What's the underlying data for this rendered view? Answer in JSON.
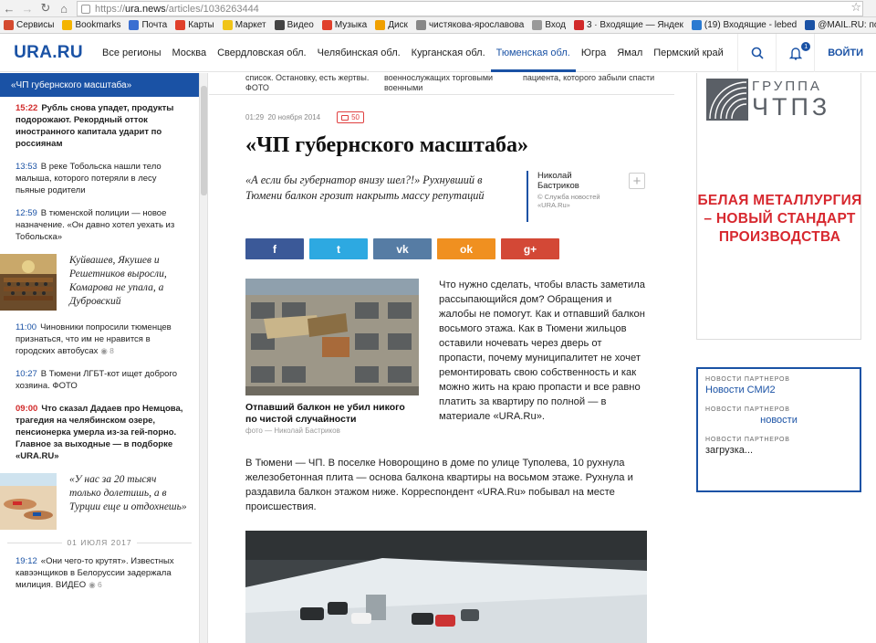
{
  "browser": {
    "url_scheme": "https://",
    "url_host": "ura.news",
    "url_path": "/articles/1036263444"
  },
  "bookmarks": [
    {
      "label": "Сервисы",
      "color": "#d44a2f"
    },
    {
      "label": "Bookmarks",
      "color": "#f4b400"
    },
    {
      "label": "Почта",
      "color": "#3a6fd1"
    },
    {
      "label": "Карты",
      "color": "#e0402b"
    },
    {
      "label": "Маркет",
      "color": "#f0c419"
    },
    {
      "label": "Видео",
      "color": "#444444"
    },
    {
      "label": "Музыка",
      "color": "#e0402b"
    },
    {
      "label": "Диск",
      "color": "#f0a000"
    },
    {
      "label": "чистякова-ярославова",
      "color": "#888888"
    },
    {
      "label": "Вход",
      "color": "#999999"
    },
    {
      "label": "3 · Входящие — Яндек",
      "color": "#d12a2a"
    },
    {
      "label": "(19) Входящие - lebed",
      "color": "#2a7ad1"
    },
    {
      "label": "@MAIL.RU: почта, пои",
      "color": "#1a52a5"
    }
  ],
  "header": {
    "logo": "URA.RU",
    "regions": [
      "Все регионы",
      "Москва",
      "Свердловская обл.",
      "Челябинская обл.",
      "Курганская обл.",
      "Тюменская обл.",
      "Югра",
      "Ямал",
      "Пермский край"
    ],
    "active_region": 5,
    "notif_count": "1",
    "login": "ВОЙТИ"
  },
  "sidebar": {
    "heading": "«ЧП губернского масштаба»",
    "items": [
      {
        "time": "15:22",
        "text": "Рубль снова упадет, продукты подорожают. Рекордный отток иностранного капитала ударит по россиянам",
        "hot": true
      },
      {
        "time": "13:53",
        "text": "В реке Тобольска нашли тело малыша, которого потеряли в лесу пьяные родители",
        "hot": false
      },
      {
        "time": "12:59",
        "text": "В тюменской полиции — новое назначение. «Он давно хотел уехать из Тобольска»",
        "hot": false
      }
    ],
    "feature1": "Куйвашев, Якушев и Решетников выросли, Комарова не упала, а Дубровский",
    "items2": [
      {
        "time": "11:00",
        "text": "Чиновники попросили тюменцев признаться, что им не нравится в городских автобусах",
        "views": "8",
        "hot": false
      },
      {
        "time": "10:27",
        "text": "В Тюмени ЛГБТ-кот ищет доброго хозяина. ФОТО",
        "hot": false
      },
      {
        "time": "09:00",
        "text": "Что сказал Дадаев про Немцова, трагедия на челябинском озере, пенсионерка умерла из-за гей-порно. Главное за выходные — в подборке «URA.RU»",
        "hot": true
      }
    ],
    "feature2": "«У нас за 20 тысяч только долетишь, а в Турции еще и отдохнешь»",
    "date_divider": "01 ИЮЛЯ 2017",
    "items3": [
      {
        "time": "19:12",
        "text": "«Они чего-то крутят». Известных кавээнщиков в Белоруссии задержала милиция. ВИДЕО",
        "views": "6",
        "hot": false
      }
    ]
  },
  "teasers": [
    "список. Остановку, есть жертвы. ФОТО",
    "военнослужащих торговыми военными",
    "пациента, которого забыли спасти"
  ],
  "article": {
    "time": "01:29",
    "date": "20 ноября 2014",
    "comments": "50",
    "title": "«ЧП губернского масштаба»",
    "lead": "«А если бы губернатор внизу шел?!» Рухнувший в Тюмени балкон грозит накрыть массу репутаций",
    "author_name": "Николай Бастриков",
    "author_credit": "© Служба новостей «URA.Ru»",
    "share": [
      {
        "label": "f",
        "color": "#3b5998"
      },
      {
        "label": "t",
        "color": "#2da9e1"
      },
      {
        "label": "vk",
        "color": "#567ca4"
      },
      {
        "label": "ok",
        "color": "#f09020"
      },
      {
        "label": "g+",
        "color": "#d34836"
      }
    ],
    "figure_caption": "Отпавший балкон не убил никого по чистой случайности",
    "figure_source": "фото — Николай Бастриков",
    "body_right": "Что нужно сделать, чтобы власть заметила рассыпающийся дом? Обращения и жалобы не помогут. Как и отпавший балкон восьмого этажа. Как в Тюмени жильцов оставили ночевать через дверь от пропасти, почему муниципалитет не хочет ремонтировать свою собственность и как можно жить на краю пропасти и все равно платить за квартиру по полной — в материале «URA.Ru».",
    "body_full": "В Тюмени — ЧП. В поселке Новорощино в доме по улице Туполева, 10 рухнула железобетонная плита — основа балкона квартиры на восьмом этаже. Рухнула и раздавила балкон этажом ниже. Корреспондент «URA.Ru» побывал на месте происшествия."
  },
  "ad": {
    "brand_line1": "ГРУППА",
    "brand_line2": "ЧТПЗ",
    "slogan": "БЕЛАЯ МЕТАЛЛУРГИЯ – НОВЫЙ СТАНДАРТ ПРОИЗВОДСТВА"
  },
  "partners": [
    {
      "label": "НОВОСТИ ПАРТНЕРОВ",
      "link": "Новости СМИ2"
    },
    {
      "label": "НОВОСТИ ПАРТНЕРОВ",
      "link": "новости"
    },
    {
      "label": "НОВОСТИ ПАРТНЕРОВ",
      "link": "загрузка..."
    }
  ]
}
